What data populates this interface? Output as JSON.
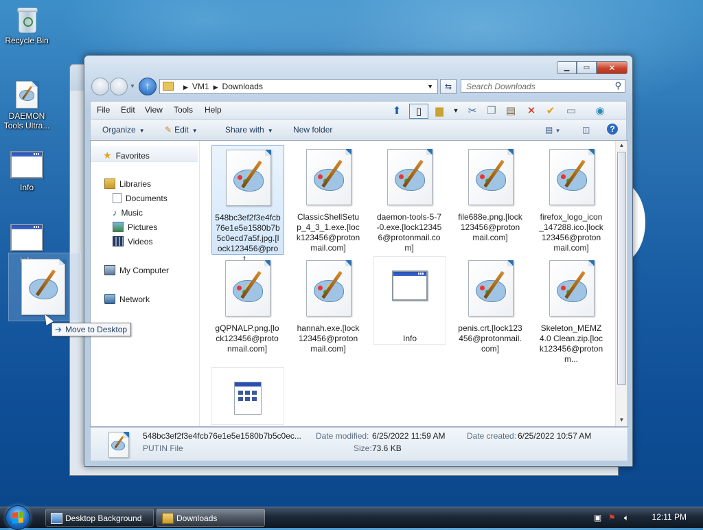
{
  "desktop": {
    "icons": [
      {
        "label": "Recycle Bin"
      },
      {
        "label": "DAEMON Tools Ultra..."
      },
      {
        "label": "Info"
      },
      {
        "label": "Info"
      }
    ],
    "drag_tooltip": "Move to Desktop"
  },
  "window": {
    "address": {
      "parts": [
        "VM1",
        "Downloads"
      ]
    },
    "search_placeholder": "Search Downloads",
    "menu": [
      "File",
      "Edit",
      "View",
      "Tools",
      "Help"
    ],
    "commands": {
      "organize": "Organize",
      "edit": "Edit",
      "share_with": "Share with",
      "new_folder": "New folder"
    },
    "nav": {
      "favorites": "Favorites",
      "libraries": "Libraries",
      "documents": "Documents",
      "music": "Music",
      "pictures": "Pictures",
      "videos": "Videos",
      "my_computer": "My Computer",
      "network": "Network"
    },
    "files": [
      {
        "name": "548bc3ef2f3e4fcb76e1e5e1580b7b5c0ecd7a5f.jpg.[lock123456@prot...",
        "icon": "paint-icon",
        "selected": true
      },
      {
        "name": "ClassicShellSetup_4_3_1.exe.[lock123456@protonmail.com]",
        "icon": "paint-icon"
      },
      {
        "name": "daemon-tools-5-7-0.exe.[lock123456@protonmail.com]",
        "icon": "paint-icon"
      },
      {
        "name": "file688e.png.[lock123456@protonmail.com]",
        "icon": "paint-icon"
      },
      {
        "name": "firefox_logo_icon_147288.ico.[lock123456@protonmail.com]",
        "icon": "paint-icon"
      },
      {
        "name": "gQPNALP.png.[lock123456@protonmail.com]",
        "icon": "paint-icon"
      },
      {
        "name": "hannah.exe.[lock123456@protonmail.com]",
        "icon": "paint-icon"
      },
      {
        "name": "Info",
        "icon": "window-app-icon"
      },
      {
        "name": "penis.crt.[lock123456@protonmail.com]",
        "icon": "paint-icon"
      },
      {
        "name": "Skeleton_MEMZ 4.0 Clean.zip.[lock123456@protonm...",
        "icon": "paint-icon"
      },
      {
        "name": "",
        "icon": "app-grid-icon"
      }
    ],
    "details": {
      "filename": "548bc3ef2f3e4fcb76e1e5e1580b7b5c0ec...",
      "type": "PUTIN File",
      "modified_label": "Date modified:",
      "modified": "6/25/2022 11:59 AM",
      "created_label": "Date created:",
      "created": "6/25/2022 10:57 AM",
      "size_label": "Size:",
      "size": "73.6 KB"
    }
  },
  "taskbar": {
    "tasks": [
      "Desktop Background",
      "Downloads"
    ],
    "clock": "12:11 PM"
  }
}
